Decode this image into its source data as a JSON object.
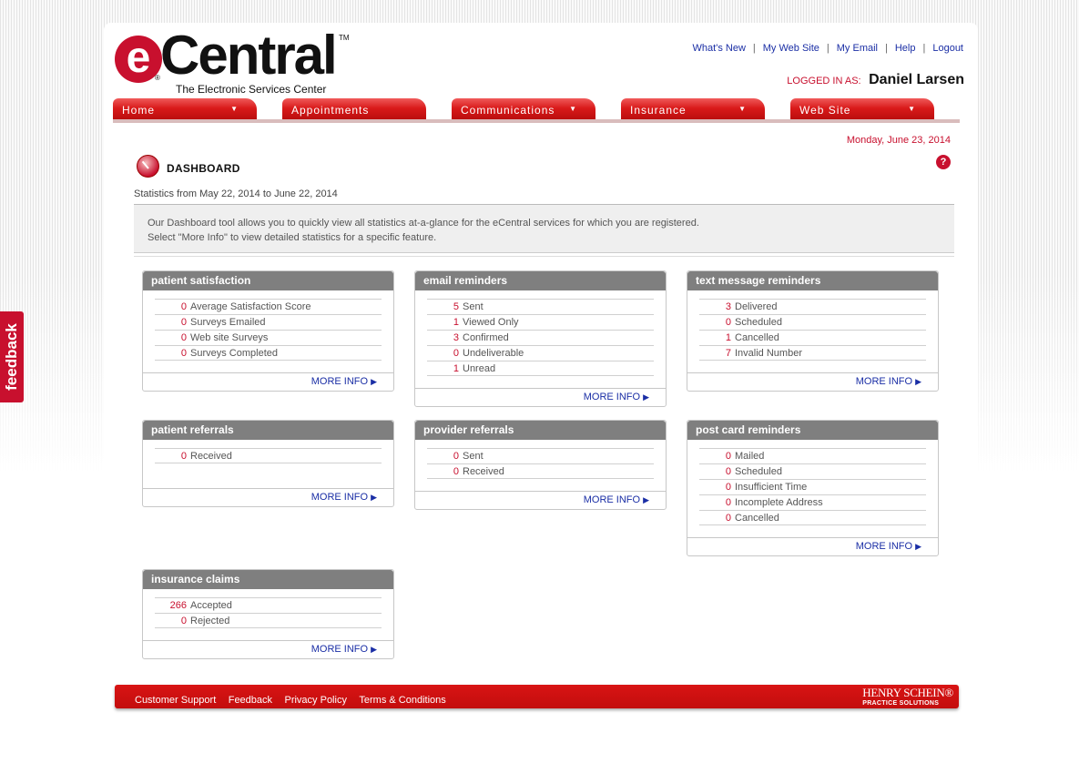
{
  "brand": {
    "logo_letter": "e",
    "logo_word": "Central",
    "tagline": "The Electronic Services Center",
    "accent_color": "#c8102e"
  },
  "top_links": [
    "What's New",
    "My Web Site",
    "My Email",
    "Help",
    "Logout"
  ],
  "logged_in": {
    "label": "LOGGED IN AS:",
    "name": "Daniel Larsen"
  },
  "nav": [
    {
      "label": "Home"
    },
    {
      "label": "Appointments"
    },
    {
      "label": "Communications"
    },
    {
      "label": "Insurance"
    },
    {
      "label": "Web Site"
    }
  ],
  "date": "Monday, June 23, 2014",
  "dashboard": {
    "title": "DASHBOARD",
    "stats_range": "Statistics from May 22, 2014  to June 22, 2014",
    "info_line1": "Our Dashboard tool allows you to quickly view all statistics at-a-glance for the eCentral services for which you are registered.",
    "info_line2": "Select \"More Info\" to view detailed statistics for a specific feature."
  },
  "more_info": "MORE INFO",
  "cards": {
    "patient_satisfaction": {
      "title": "patient satisfaction",
      "rows": [
        {
          "value": "0",
          "label": "Average Satisfaction Score"
        },
        {
          "value": "0",
          "label": "Surveys Emailed"
        },
        {
          "value": "0",
          "label": "Web site Surveys"
        },
        {
          "value": "0",
          "label": "Surveys Completed"
        }
      ]
    },
    "email_reminders": {
      "title": "email reminders",
      "rows": [
        {
          "value": "5",
          "label": "Sent"
        },
        {
          "value": "1",
          "label": "Viewed Only"
        },
        {
          "value": "3",
          "label": "Confirmed"
        },
        {
          "value": "0",
          "label": "Undeliverable"
        },
        {
          "value": "1",
          "label": "Unread"
        }
      ]
    },
    "text_message_reminders": {
      "title": "text message reminders",
      "rows": [
        {
          "value": "3",
          "label": "Delivered"
        },
        {
          "value": "0",
          "label": "Scheduled"
        },
        {
          "value": "1",
          "label": "Cancelled"
        },
        {
          "value": "7",
          "label": "Invalid Number"
        }
      ]
    },
    "patient_referrals": {
      "title": "patient referrals",
      "rows": [
        {
          "value": "0",
          "label": "Received"
        }
      ]
    },
    "provider_referrals": {
      "title": "provider referrals",
      "rows": [
        {
          "value": "0",
          "label": "Sent"
        },
        {
          "value": "0",
          "label": "Received"
        }
      ]
    },
    "post_card_reminders": {
      "title": "post card reminders",
      "rows": [
        {
          "value": "0",
          "label": "Mailed"
        },
        {
          "value": "0",
          "label": "Scheduled"
        },
        {
          "value": "0",
          "label": "Insufficient Time"
        },
        {
          "value": "0",
          "label": "Incomplete Address"
        },
        {
          "value": "0",
          "label": "Cancelled"
        }
      ]
    },
    "insurance_claims": {
      "title": "insurance claims",
      "rows": [
        {
          "value": "266",
          "label": "Accepted"
        },
        {
          "value": "0",
          "label": "Rejected"
        }
      ]
    }
  },
  "footer": {
    "links": [
      "Customer Support",
      "Feedback",
      "Privacy Policy",
      "Terms & Conditions"
    ],
    "brand_line1": "HENRY SCHEIN®",
    "brand_line2": "PRACTICE SOLUTIONS"
  },
  "feedback_tab": "feedback"
}
